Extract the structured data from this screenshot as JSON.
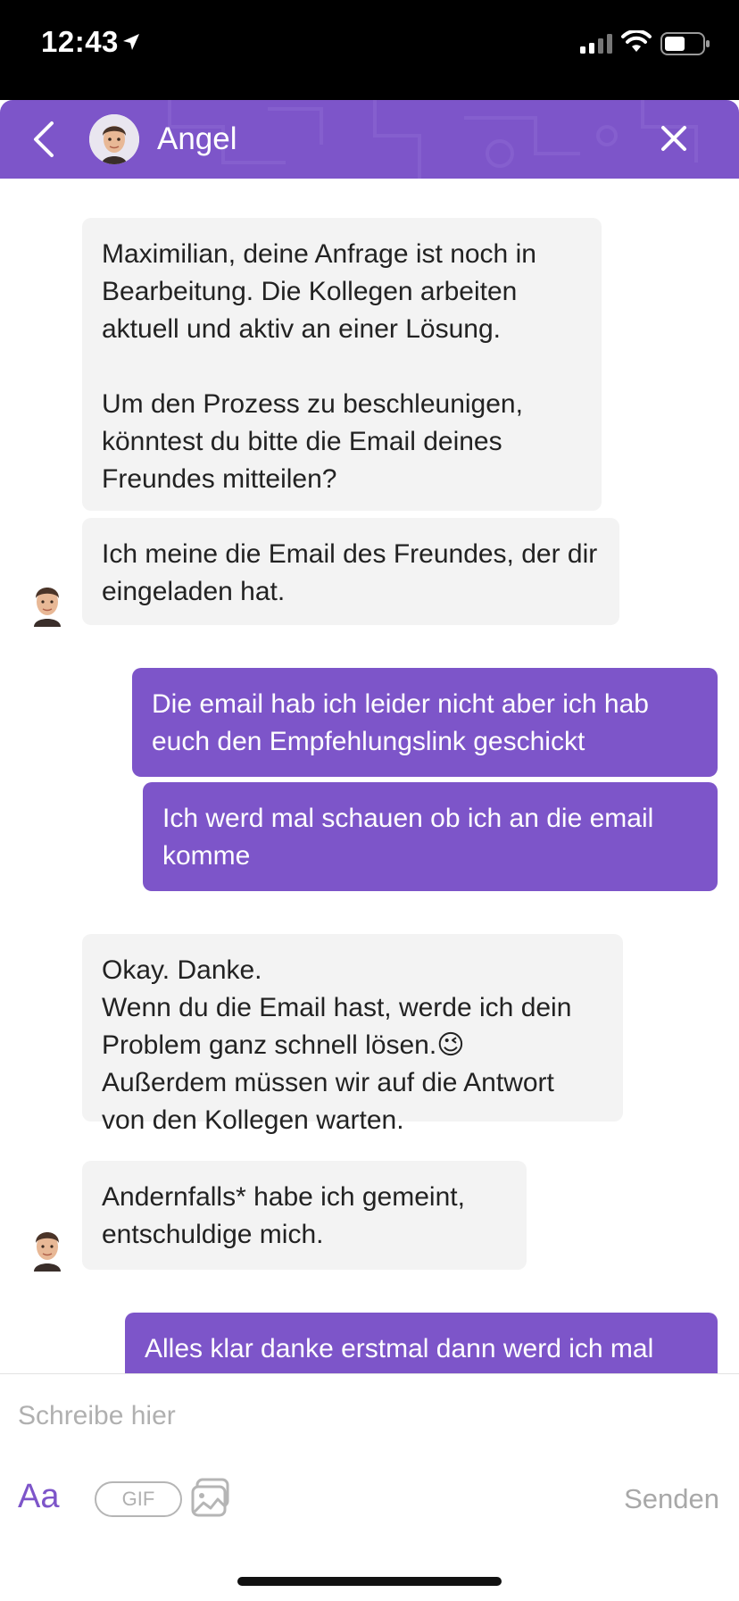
{
  "status_bar": {
    "time": "12:43",
    "icons": [
      "location-arrow-icon",
      "signal-icon",
      "wifi-icon",
      "battery-icon"
    ]
  },
  "header": {
    "contact_name": "Angel",
    "icons": [
      "back-chevron-icon",
      "avatar",
      "close-icon"
    ],
    "color": "#7d55c9"
  },
  "messages": [
    {
      "side": "in",
      "text": "Maximilian, deine Anfrage ist noch in Bearbeitung. Die Kollegen arbeiten aktuell und aktiv an einer Lösung.\n\nUm den Prozess zu beschleunigen, könntest du bitte die Email deines Freundes mitteilen?"
    },
    {
      "side": "in",
      "text": "Ich meine die Email des Freundes, der dir eingeladen hat."
    },
    {
      "side": "out",
      "text": "Die email hab ich leider nicht aber ich hab euch den Empfehlungslink geschickt"
    },
    {
      "side": "out",
      "text": "Ich werd mal schauen ob ich an die email komme"
    },
    {
      "side": "in",
      "text": "Okay. Danke.\nWenn du die Email hast, werde ich dein Problem ganz schnell lösen.😉\nAußerdem müssen wir auf die Antwort von den Kollegen warten."
    },
    {
      "side": "in",
      "text": "Andernfalls* habe ich gemeint, entschuldige mich."
    },
    {
      "side": "out",
      "text": "Alles klar danke erstmal dann werd ich mal"
    }
  ],
  "composer": {
    "placeholder": "Schreibe hier",
    "aa_label": "Aa",
    "gif_label": "GIF",
    "send_label": "Senden"
  },
  "colors": {
    "accent": "#7d55c9",
    "incoming_bubble": "#f3f3f3"
  }
}
